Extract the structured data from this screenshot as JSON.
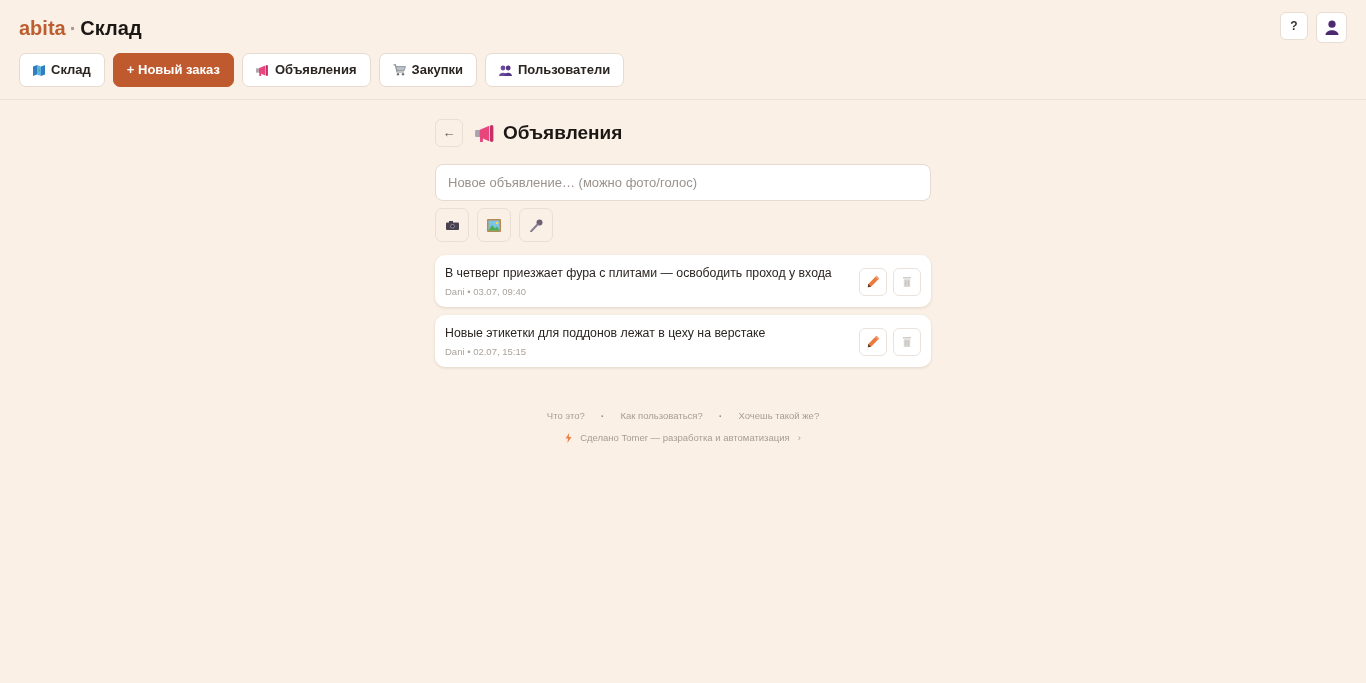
{
  "header": {
    "brand": "abita",
    "separator": "·",
    "title": "Склад",
    "help_button": "?"
  },
  "nav": [
    {
      "kind": "link",
      "label": "Склад"
    },
    {
      "kind": "action",
      "label": "+ Новый заказ"
    },
    {
      "kind": "link",
      "label": "Объявления"
    },
    {
      "kind": "link",
      "label": "Закупки"
    },
    {
      "kind": "link",
      "label": "Пользователи"
    }
  ],
  "page": {
    "back_button": "←",
    "title": "Объявления"
  },
  "composer": {
    "placeholder": "Новое объявление… (можно фото/голос)"
  },
  "announcements": [
    {
      "text": "В четверг приезжает фура с плитами — освободить проход у входа",
      "meta": "Dani • 03.07, 09:40"
    },
    {
      "text": "Новые этикетки для поддонов лежат в цеху на верстаке",
      "meta": "Dani • 02.07, 15:15"
    }
  ],
  "footer": {
    "links": [
      "Что это?",
      "Как пользоваться?",
      "Хочешь такой же?"
    ],
    "separators": [
      "·",
      "·"
    ],
    "credit": "Сделано Tomer — разработка и автоматизация",
    "chevron": "›"
  }
}
